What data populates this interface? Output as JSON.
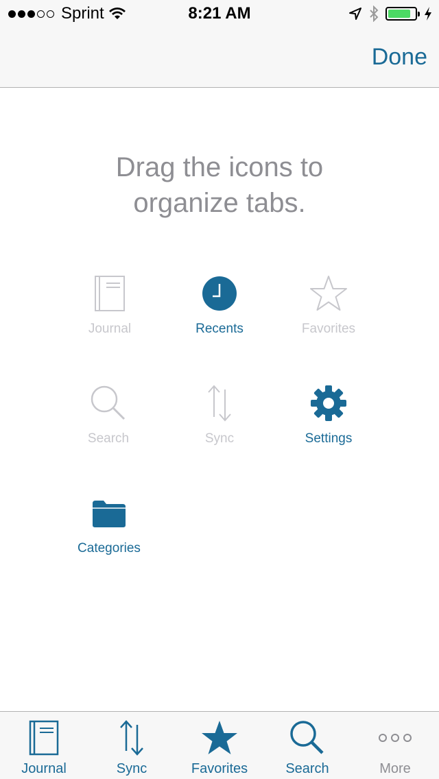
{
  "status_bar": {
    "carrier": "Sprint",
    "time": "8:21 AM",
    "signal_bars_filled": 3,
    "signal_bars_total": 5,
    "battery_level": 0.85,
    "battery_color": "#4cd964",
    "icons": [
      "wifi-icon",
      "location-arrow-icon",
      "bluetooth-icon",
      "battery-icon",
      "charging-bolt-icon"
    ]
  },
  "nav": {
    "done_label": "Done"
  },
  "instructions": {
    "line1": "Drag the icons to",
    "line2": "organize tabs."
  },
  "colors": {
    "accent": "#1a6a96",
    "disabled": "#c7c7cc",
    "hint": "#8e8e93"
  },
  "available_tabs": [
    {
      "label": "Journal",
      "icon": "journal-icon",
      "active": false
    },
    {
      "label": "Recents",
      "icon": "clock-icon",
      "active": true
    },
    {
      "label": "Favorites",
      "icon": "star-icon",
      "active": false
    },
    {
      "label": "Search",
      "icon": "search-icon",
      "active": false
    },
    {
      "label": "Sync",
      "icon": "sync-icon",
      "active": false
    },
    {
      "label": "Settings",
      "icon": "gear-icon",
      "active": true
    },
    {
      "label": "Categories",
      "icon": "folder-icon",
      "active": true
    }
  ],
  "tab_bar": {
    "items": [
      {
        "label": "Journal",
        "icon": "journal-icon"
      },
      {
        "label": "Sync",
        "icon": "sync-icon"
      },
      {
        "label": "Favorites",
        "icon": "star-icon"
      },
      {
        "label": "Search",
        "icon": "search-icon"
      },
      {
        "label": "More",
        "icon": "more-icon"
      }
    ]
  }
}
